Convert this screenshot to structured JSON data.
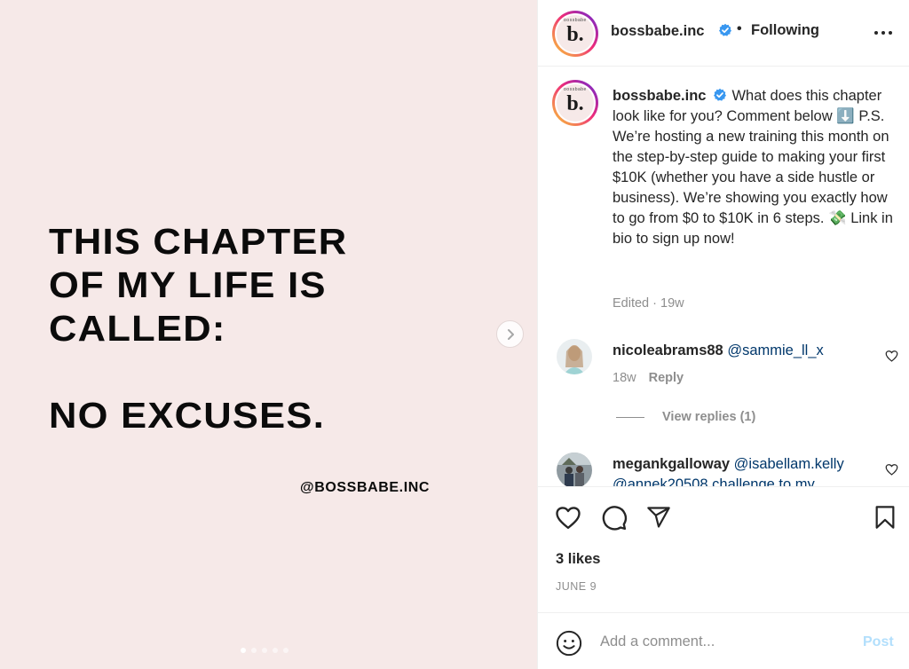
{
  "post": {
    "headline_lines": [
      "THIS CHAPTER",
      "OF MY LIFE IS",
      "CALLED:"
    ],
    "headline_emphasis": "NO EXCUSES.",
    "watermark": "@BOSSBABE.INC",
    "carousel": {
      "slides": 5,
      "active_slide": 1
    },
    "background_color": "#f6e9e8"
  },
  "header": {
    "avatar_letter": "b.",
    "avatar_arc_text": "bossbabe",
    "username": "bossbabe.inc",
    "separator": "•",
    "follow_label": "Following"
  },
  "caption": {
    "username": "bossbabe.inc",
    "text": "What does this chapter look like for you? Comment below ⬇️ P.S. We’re hosting a new training this month on the step-by-step guide to making your first $10K (whether you have a side hustle or business). We’re showing you exactly how to go from $0 to $10K in 6 steps. 💸 Link in bio to sign up now!",
    "meta": "Edited · 19w"
  },
  "comments": [
    {
      "username": "nicoleabrams88",
      "text": "@sammie_ll_x",
      "time": "18w",
      "reply_label": "Reply",
      "view_replies": "View replies (1)"
    },
    {
      "username": "megankgalloway",
      "text": "@isabellam.kelly",
      "text_line2": "@annek20508 challenge to my"
    }
  ],
  "actions": {
    "likes": "3 likes",
    "date": "JUNE 9"
  },
  "add_comment": {
    "placeholder": "Add a comment...",
    "post_label": "Post"
  },
  "colors": {
    "verified": "#3897f0",
    "mention": "#00376b",
    "muted": "#8e8e8e",
    "post_disabled": "#b2dffc"
  }
}
